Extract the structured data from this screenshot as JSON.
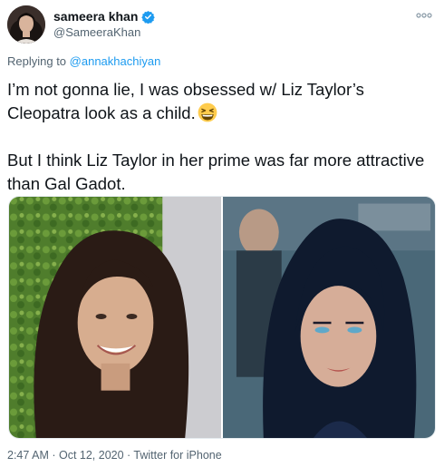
{
  "user": {
    "display_name": "sameera khan",
    "handle": "@SameeraKhan"
  },
  "icons": {
    "verified": "verified-badge-icon",
    "more": "more-options-icon",
    "emoji": "grinning-squinting-face-emoji"
  },
  "reply": {
    "prefix": "Replying to ",
    "mention": "@annakhachiyan"
  },
  "tweet": {
    "line1": "I’m not gonna lie, I was obsessed w/ Liz Taylor’s Cleopatra look as a child.",
    "line2": "But I think Liz Taylor in her prime was far more attractive than Gal Gadot."
  },
  "meta": {
    "timestamp": "2:47 AM · Oct 12, 2020 · Twitter for iPhone"
  },
  "colors": {
    "accent": "#1d9bf0",
    "secondary_text": "#536471",
    "primary_text": "#0f1419"
  }
}
